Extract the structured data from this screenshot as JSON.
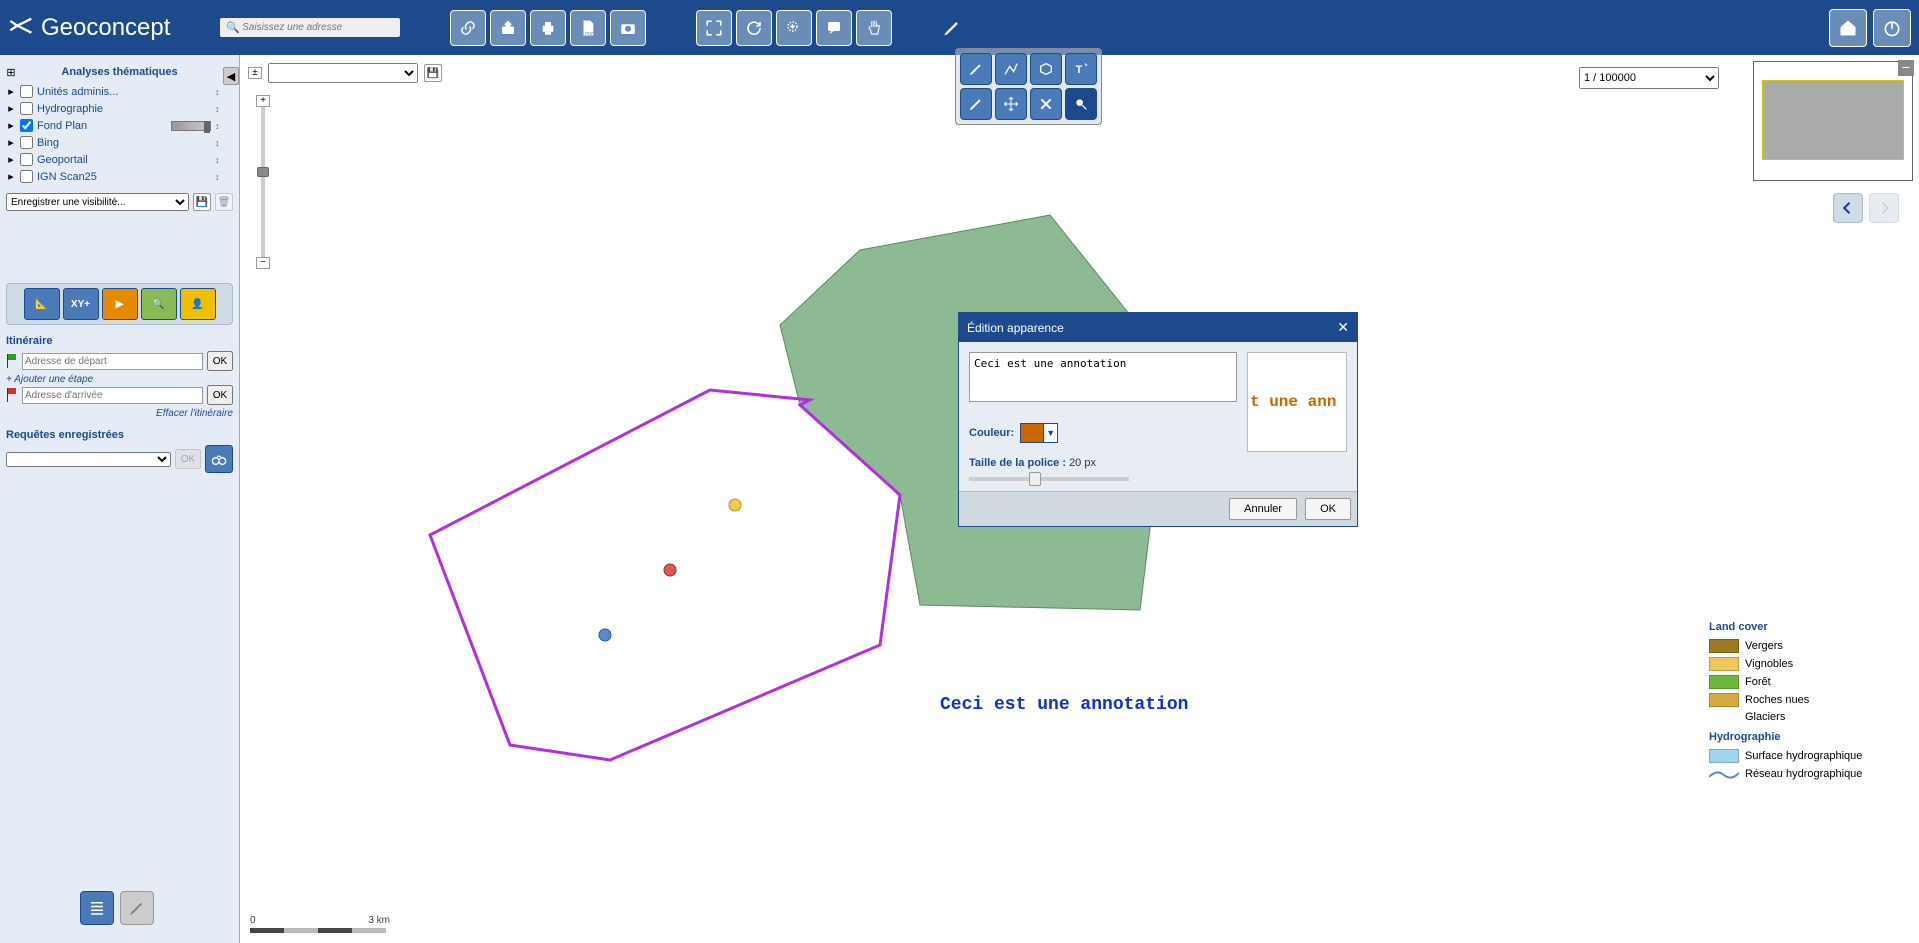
{
  "brand": "Geoconcept",
  "search": {
    "placeholder": "Saisissez une adresse"
  },
  "sidebar": {
    "header": "Analyses thématiques",
    "layers": [
      {
        "label": "Unités adminis...",
        "checked": false,
        "slider": false
      },
      {
        "label": "Hydrographie",
        "checked": false,
        "slider": false
      },
      {
        "label": "Fond Plan",
        "checked": true,
        "slider": true
      },
      {
        "label": "Bing",
        "checked": false,
        "slider": false
      },
      {
        "label": "Geoportail",
        "checked": false,
        "slider": false
      },
      {
        "label": "IGN Scan25",
        "checked": false,
        "slider": false
      }
    ],
    "visibility_placeholder": "Enregistrer une visibilité...",
    "itinerary": {
      "title": "Itinéraire",
      "start_label": "Adresse de départ",
      "add_step": "+ Ajouter une étape",
      "end_label": "Adresse d'arrivée",
      "ok": "OK",
      "erase": "Effacer l'itinéraire"
    },
    "queries": {
      "title": "Requêtes enregistrées",
      "ok": "OK"
    }
  },
  "map": {
    "scale_selected": "1 / 100000",
    "scale_bar": {
      "zero": "0",
      "dist": "3 km"
    },
    "annotation": "Ceci est une annotation"
  },
  "dialog": {
    "title": "Édition apparence",
    "text": "Ceci est une annotation",
    "color_label": "Couleur:",
    "color_value": "#cc6600",
    "font_label": "Taille de la police :",
    "font_value": "20 px",
    "preview_text": "t une ann",
    "cancel": "Annuler",
    "ok": "OK"
  },
  "legend": {
    "landcover_title": "Land cover",
    "landcover": [
      {
        "label": "Vergers",
        "color": "#9c7a1f"
      },
      {
        "label": "Vignobles",
        "color": "#eec75a"
      },
      {
        "label": "Forêt",
        "color": "#6eb83f"
      },
      {
        "label": "Roches nues",
        "color": "#d6a93f"
      },
      {
        "label": "Glaciers",
        "color": ""
      }
    ],
    "hydro_title": "Hydrographie",
    "hydro": [
      {
        "label": "Surface hydrographique",
        "color": "#a2d6f0"
      },
      {
        "label": "Réseau hydrographique",
        "color": "line"
      }
    ]
  }
}
